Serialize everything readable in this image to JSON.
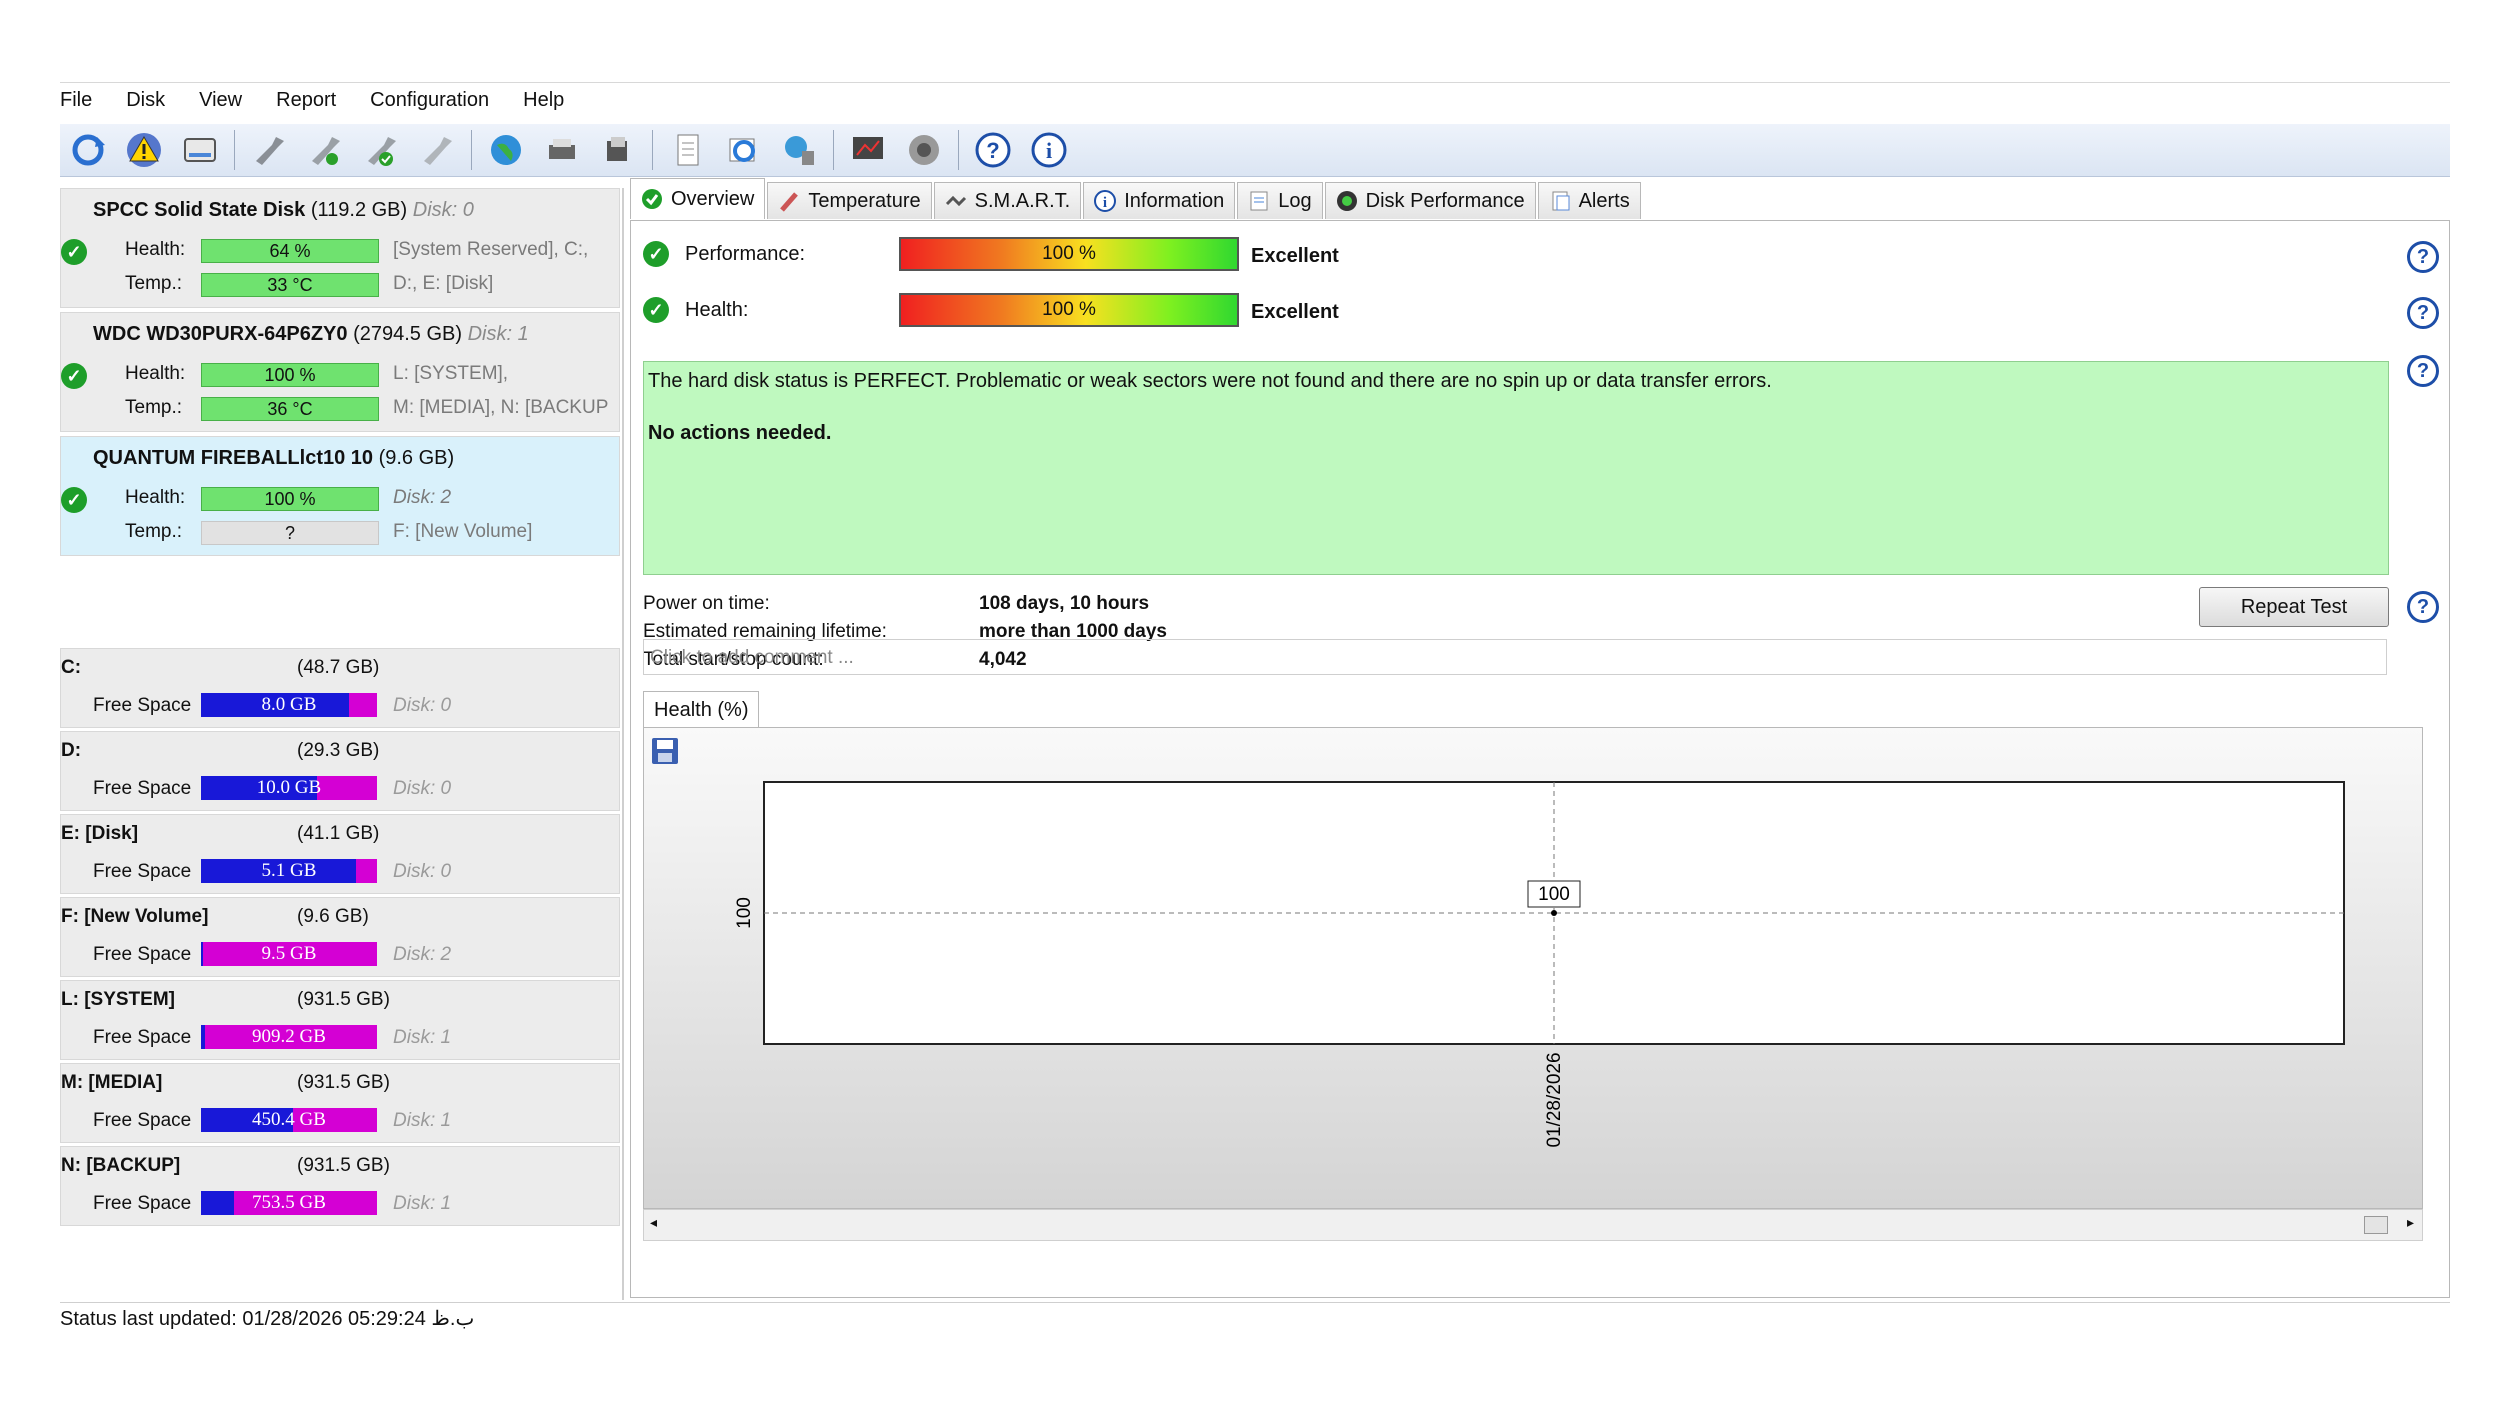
{
  "menu": [
    "File",
    "Disk",
    "View",
    "Report",
    "Configuration",
    "Help"
  ],
  "toolbar_icons": [
    "refresh-icon",
    "warning-icon",
    "disk-icon",
    "wrench-icon",
    "wrench-check-icon",
    "wrench-ok-icon",
    "wrench-settings-icon",
    "globe-icon",
    "printer-icon",
    "scanner-icon",
    "document-icon",
    "sync-icon",
    "network-icon",
    "monitor-icon",
    "speaker-icon",
    "help-icon",
    "info-icon"
  ],
  "disks": [
    {
      "name": "SPCC Solid State Disk",
      "size": "(119.2 GB)",
      "disk": "Disk: 0",
      "health_label": "Health:",
      "health": "64 %",
      "temp_label": "Temp.:",
      "temp": "33 °C",
      "parts_line1": "[System Reserved], C:,",
      "parts_line2": "D:, E: [Disk]"
    },
    {
      "name": "WDC WD30PURX-64P6ZY0",
      "size": "(2794.5 GB)",
      "disk": "Disk: 1",
      "health_label": "Health:",
      "health": "100 %",
      "temp_label": "Temp.:",
      "temp": "36 °C",
      "parts_line1": "L: [SYSTEM],",
      "parts_line2": "M: [MEDIA], N: [BACKUP"
    },
    {
      "name": "QUANTUM FIREBALLlct10 10",
      "size": "(9.6 GB)",
      "disk": "",
      "health_label": "Health:",
      "health": "100 %",
      "temp_label": "Temp.:",
      "temp": "?",
      "parts_line1": "Disk: 2",
      "parts_line2": "F: [New Volume]"
    }
  ],
  "partitions": [
    {
      "name": "C:",
      "size": "(48.7 GB)",
      "label": "Free Space",
      "free": "8.0 GB",
      "fill": 0.84,
      "disk": "Disk: 0"
    },
    {
      "name": "D:",
      "size": "(29.3 GB)",
      "label": "Free Space",
      "free": "10.0 GB",
      "fill": 0.66,
      "disk": "Disk: 0"
    },
    {
      "name": "E: [Disk]",
      "size": "(41.1 GB)",
      "label": "Free Space",
      "free": "5.1 GB",
      "fill": 0.88,
      "disk": "Disk: 0"
    },
    {
      "name": "F: [New Volume]",
      "size": "(9.6 GB)",
      "label": "Free Space",
      "free": "9.5 GB",
      "fill": 0.01,
      "disk": "Disk: 2"
    },
    {
      "name": "L: [SYSTEM]",
      "size": "(931.5 GB)",
      "label": "Free Space",
      "free": "909.2 GB",
      "fill": 0.02,
      "disk": "Disk: 1"
    },
    {
      "name": "M: [MEDIA]",
      "size": "(931.5 GB)",
      "label": "Free Space",
      "free": "450.4 GB",
      "fill": 0.52,
      "disk": "Disk: 1"
    },
    {
      "name": "N: [BACKUP]",
      "size": "(931.5 GB)",
      "label": "Free Space",
      "free": "753.5 GB",
      "fill": 0.19,
      "disk": "Disk: 1"
    }
  ],
  "tabs": [
    "Overview",
    "Temperature",
    "S.M.A.R.T.",
    "Information",
    "Log",
    "Disk Performance",
    "Alerts"
  ],
  "overview": {
    "performance_label": "Performance:",
    "performance_value": "100 %",
    "performance_rating": "Excellent",
    "health_label": "Health:",
    "health_value": "100 %",
    "health_rating": "Excellent",
    "status_line1": "The hard disk status is PERFECT. Problematic or weak sectors were not found and there are no spin up or data transfer errors.",
    "status_line2": "No actions needed.",
    "power_on_label": "Power on time:",
    "power_on_value": "108 days, 10 hours",
    "lifetime_label": "Estimated remaining lifetime:",
    "lifetime_value": "more than 1000 days",
    "startstop_label": "Total start/stop count:",
    "startstop_value": "4,042",
    "repeat_button": "Repeat Test",
    "comment_placeholder": "Click to add comment ...",
    "chart_tab": "Health (%)"
  },
  "chart_data": {
    "type": "line",
    "x": [
      "01/28/2026"
    ],
    "series": [
      {
        "values": [
          100
        ]
      }
    ],
    "data_labels": [
      "100"
    ],
    "ytick": "100",
    "xtick": "01/28/2026",
    "ylim": [
      0,
      200
    ]
  },
  "statusbar": "Status last updated: 01/28/2026 05:29:24 ب.ظ",
  "colors": {
    "health_green": "#6fe26f",
    "free_space": "#d400d4",
    "used_space": "#1818d8",
    "status_ok": "#bff9bf",
    "selected": "#d9f1fb"
  }
}
